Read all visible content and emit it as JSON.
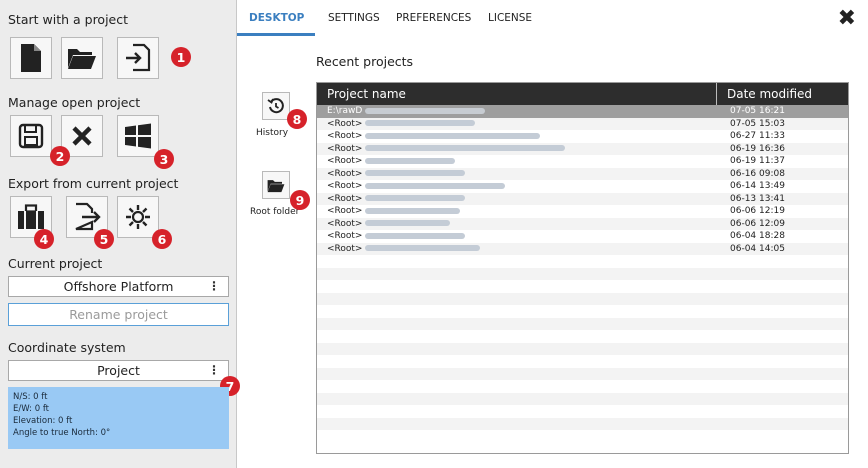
{
  "left": {
    "start_title": "Start with a project",
    "manage_title": "Manage open project",
    "export_title": "Export from current project",
    "current_title": "Current project",
    "current_value": "Offshore Platform",
    "rename_placeholder": "Rename project",
    "coord_title": "Coordinate system",
    "coord_value": "Project",
    "coord_info": {
      "ns": "N/S:  0 ft",
      "ew": "E/W:  0 ft",
      "elev": "Elevation:  0 ft",
      "angle": "Angle to true North:  0°"
    },
    "menu_glyph": "⋮"
  },
  "badges": [
    "1",
    "2",
    "3",
    "4",
    "5",
    "6",
    "7",
    "8",
    "9"
  ],
  "tabs": [
    "DESKTOP",
    "SETTINGS",
    "PREFERENCES",
    "LICENSE"
  ],
  "close_glyph": "✖",
  "side": {
    "history_label": "History",
    "root_label": "Root folder"
  },
  "recent": {
    "title": "Recent projects",
    "col_name": "Project name",
    "col_date": "Date modified",
    "rows": [
      {
        "prefix": "E:\\rawD",
        "date": "07-05 16:21"
      },
      {
        "prefix": "<Root>",
        "date": "07-05 15:03"
      },
      {
        "prefix": "<Root>",
        "date": "06-27 11:33"
      },
      {
        "prefix": "<Root>",
        "date": "06-19 16:36"
      },
      {
        "prefix": "<Root>",
        "date": "06-19 11:37"
      },
      {
        "prefix": "<Root>",
        "date": "06-16 09:08"
      },
      {
        "prefix": "<Root>",
        "date": "06-14 13:49"
      },
      {
        "prefix": "<Root>",
        "date": "06-13 13:41"
      },
      {
        "prefix": "<Root>",
        "date": "06-06 12:19"
      },
      {
        "prefix": "<Root>",
        "date": "06-06 12:09"
      },
      {
        "prefix": "<Root>",
        "date": "06-04 18:28"
      },
      {
        "prefix": "<Root>",
        "date": "06-04 14:05"
      }
    ]
  }
}
